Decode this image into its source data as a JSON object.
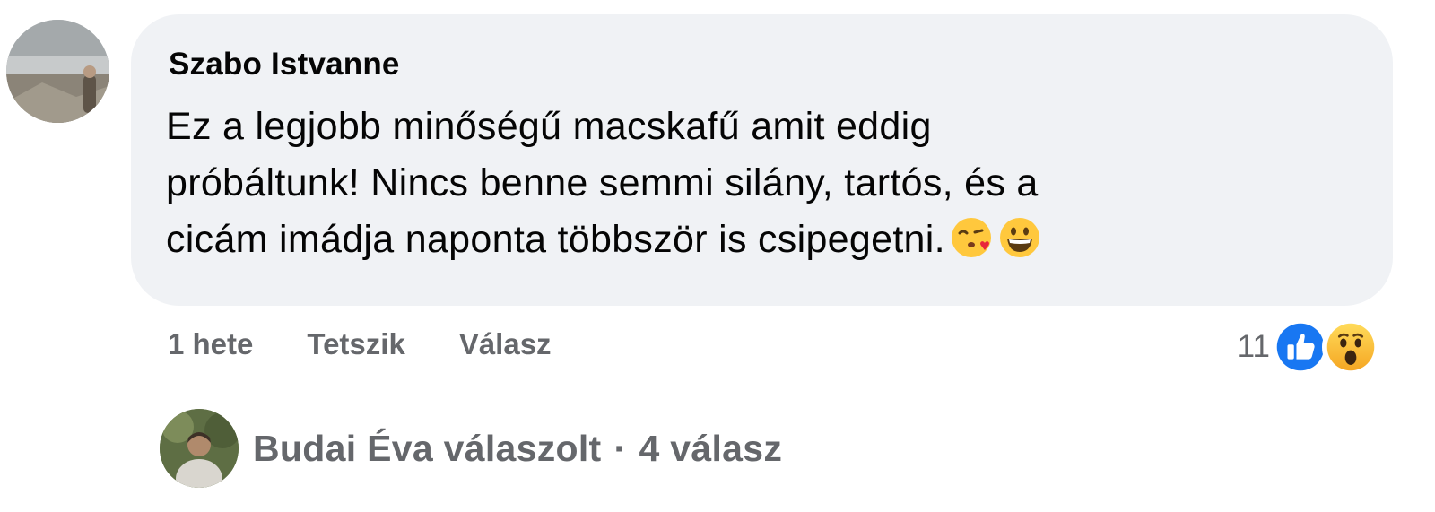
{
  "comment": {
    "author": "Szabo Istvanne",
    "text_lines": [
      "Ez a legjobb minőségű macskafű amit eddig",
      "próbáltunk! Nincs benne semmi silány, tartós, és a",
      "cicám imádja naponta többször is csipegetni."
    ],
    "trailing_emojis": [
      "kiss-heart-emoji",
      "grinning-emoji"
    ]
  },
  "actions": {
    "time": "1 hete",
    "like_label": "Tetszik",
    "reply_label": "Válasz"
  },
  "reactions": {
    "count": "11",
    "icons": [
      "like-icon",
      "wow-icon"
    ],
    "like_color": "#1877f2"
  },
  "replies": {
    "author_text": "Budai Éva válaszolt",
    "separator": "·",
    "count_text": "4 válasz"
  },
  "colors": {
    "bubble": "#f0f2f5",
    "secondary_text": "#65676b",
    "primary_text": "#050505"
  }
}
